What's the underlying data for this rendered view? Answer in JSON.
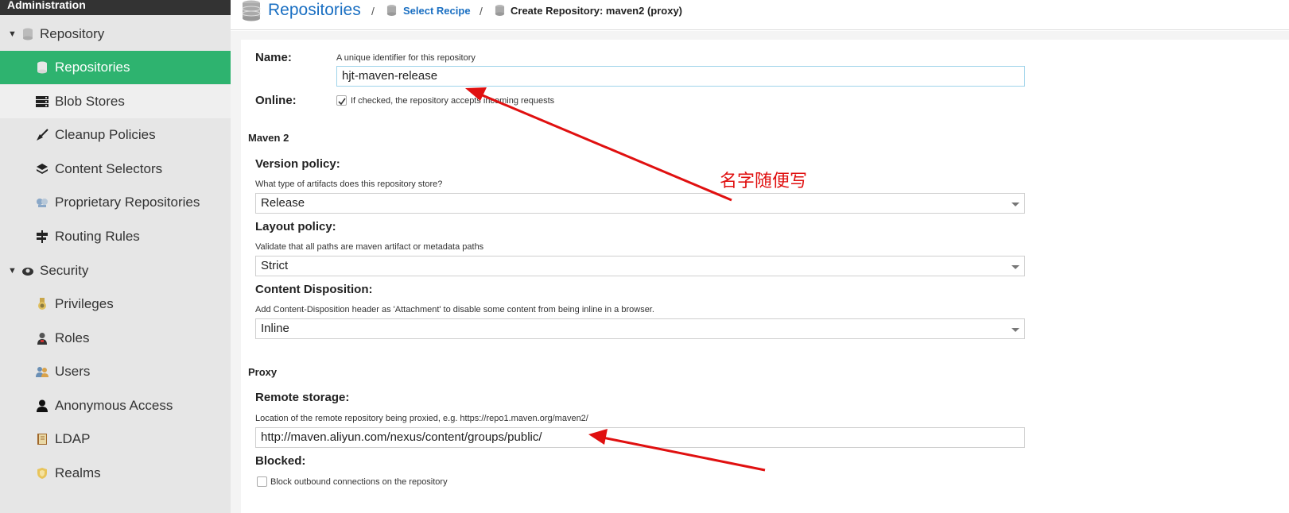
{
  "sidebar": {
    "header": "Administration",
    "items": [
      {
        "label": "Repository"
      },
      {
        "label": "Repositories"
      },
      {
        "label": "Blob Stores"
      },
      {
        "label": "Cleanup Policies"
      },
      {
        "label": "Content Selectors"
      },
      {
        "label": "Proprietary Repositories"
      },
      {
        "label": "Routing Rules"
      },
      {
        "label": "Security"
      },
      {
        "label": "Privileges"
      },
      {
        "label": "Roles"
      },
      {
        "label": "Users"
      },
      {
        "label": "Anonymous Access"
      },
      {
        "label": "LDAP"
      },
      {
        "label": "Realms"
      }
    ]
  },
  "breadcrumb": {
    "title": "Repositories",
    "sep": "/",
    "link": "Select Recipe",
    "current": "Create Repository: maven2 (proxy)"
  },
  "form": {
    "name_label": "Name:",
    "name_help": "A unique identifier for this repository",
    "name_value": "hjt-maven-release",
    "online_label": "Online:",
    "online_help": "If checked, the repository accepts incoming requests",
    "online_checked": true,
    "maven_section": "Maven 2",
    "version_label": "Version policy:",
    "version_help": "What type of artifacts does this repository store?",
    "version_value": "Release",
    "layout_label": "Layout policy:",
    "layout_help": "Validate that all paths are maven artifact or metadata paths",
    "layout_value": "Strict",
    "disposition_label": "Content Disposition:",
    "disposition_help": "Add Content-Disposition header as 'Attachment' to disable some content from being inline in a browser.",
    "disposition_value": "Inline",
    "proxy_section": "Proxy",
    "remote_label": "Remote storage:",
    "remote_help": "Location of the remote repository being proxied, e.g. https://repo1.maven.org/maven2/",
    "remote_value": "http://maven.aliyun.com/nexus/content/groups/public/",
    "blocked_label": "Blocked:",
    "blocked_help": "Block outbound connections on the repository",
    "blocked_checked": false
  },
  "annotation": {
    "text": "名字随便写",
    "color": "#e01010"
  },
  "colors": {
    "active": "#2eb36f",
    "link": "#1a6fc2"
  }
}
